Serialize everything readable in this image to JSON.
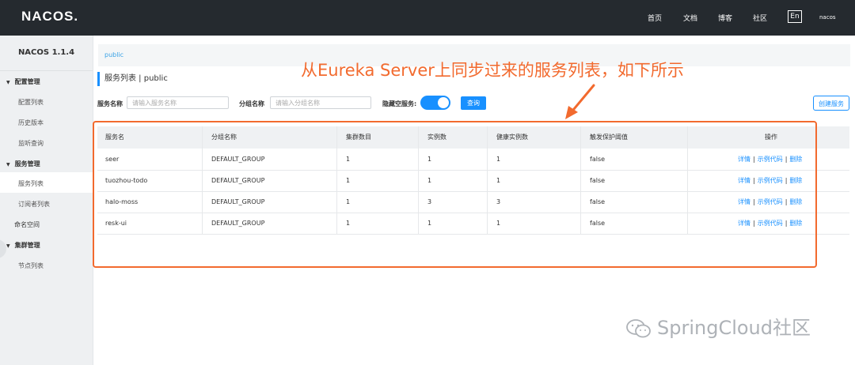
{
  "header": {
    "logo": "NACOS.",
    "nav": [
      "首页",
      "文档",
      "博客",
      "社区"
    ],
    "lang": "En",
    "user": "nacos"
  },
  "sidebar": {
    "version": "NACOS 1.1.4",
    "groups": [
      {
        "label": "配置管理",
        "items": [
          "配置列表",
          "历史版本",
          "监听查询"
        ]
      },
      {
        "label": "服务管理",
        "items": [
          "服务列表",
          "订阅者列表"
        ]
      },
      {
        "label": "命名空间",
        "items": []
      },
      {
        "label": "集群管理",
        "items": [
          "节点列表"
        ]
      }
    ]
  },
  "breadcrumb": "public",
  "page_title": "服务列表 | public",
  "filters": {
    "service_label": "服务名称",
    "service_placeholder": "请输入服务名称",
    "group_label": "分组名称",
    "group_placeholder": "请输入分组名称",
    "hide_empty_label": "隐藏空服务:",
    "query_button": "查询",
    "create_button": "创建服务"
  },
  "table": {
    "columns": [
      "服务名",
      "分组名称",
      "集群数目",
      "实例数",
      "健康实例数",
      "触发保护阈值",
      "操作"
    ],
    "rows": [
      {
        "name": "seer",
        "group": "DEFAULT_GROUP",
        "clusters": "1",
        "instances": "1",
        "healthy": "1",
        "protect": "false"
      },
      {
        "name": "tuozhou-todo",
        "group": "DEFAULT_GROUP",
        "clusters": "1",
        "instances": "1",
        "healthy": "1",
        "protect": "false"
      },
      {
        "name": "halo-moss",
        "group": "DEFAULT_GROUP",
        "clusters": "1",
        "instances": "3",
        "healthy": "3",
        "protect": "false"
      },
      {
        "name": "resk-ui",
        "group": "DEFAULT_GROUP",
        "clusters": "1",
        "instances": "1",
        "healthy": "1",
        "protect": "false"
      }
    ],
    "ops": [
      "详情",
      "示例代码",
      "删除"
    ],
    "op_sep": "|"
  },
  "annotation": "从Eureka Server上同步过来的服务列表，如下所示",
  "watermark": "SpringCloud社区",
  "colors": {
    "accent": "#1890ff",
    "annotation": "#f26a2e",
    "topbar": "#252a2f"
  }
}
